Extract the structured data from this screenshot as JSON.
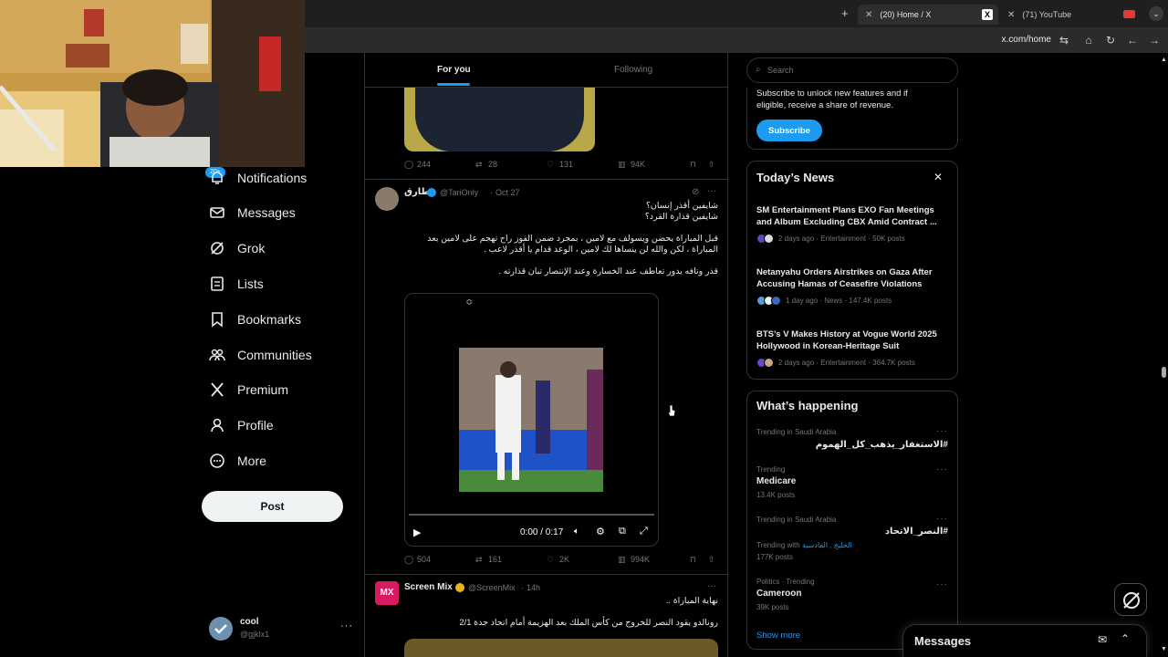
{
  "browser": {
    "tabs": [
      {
        "label": "(20) Home / X",
        "active": true
      },
      {
        "label": "(71) YouTube",
        "active": false
      }
    ],
    "address": "x.com/home"
  },
  "nav": {
    "notifications_badge": "20+",
    "items": [
      {
        "label": "Notifications",
        "icon": "bell-icon"
      },
      {
        "label": "Messages",
        "icon": "envelope-icon"
      },
      {
        "label": "Grok",
        "icon": "grok-icon"
      },
      {
        "label": "Lists",
        "icon": "list-icon"
      },
      {
        "label": "Bookmarks",
        "icon": "bookmark-icon"
      },
      {
        "label": "Communities",
        "icon": "communities-icon"
      },
      {
        "label": "Premium",
        "icon": "x-logo-icon"
      },
      {
        "label": "Profile",
        "icon": "person-icon"
      },
      {
        "label": "More",
        "icon": "more-circle-icon"
      }
    ],
    "post_label": "Post",
    "account": {
      "name": "cool",
      "handle": "@gjklx1"
    }
  },
  "feed": {
    "tabs": [
      "For you",
      "Following"
    ],
    "prev_actions": {
      "replies": "244",
      "reposts": "28",
      "likes": "131",
      "views": "94K"
    },
    "tweet1": {
      "name": "طارق",
      "handle": "@TariOnly",
      "time": "Oct 27",
      "lines": [
        "شايفين أقذر إنسان؟",
        "شايفين قذارة القرد؟",
        "قبل المباراة يحضن ويسولف مع لامين ، بمجرد ضمن الفوز راح تهجم على لامين بعد",
        "المباراة ، لكن والله لن ينساها لك لامين ، الوعد قدام يا أقذر لاعب .",
        "قذر وتافه يدور تعاطف عند الخسارة وعند الإنتصار تبان قذارته ."
      ],
      "video_time": "0:00 / 0:17",
      "actions": {
        "replies": "504",
        "reposts": "161",
        "likes": "2K",
        "views": "994K"
      }
    },
    "tweet2": {
      "name": "Screen Mix",
      "handle": "@ScreenMix",
      "time": "14h",
      "avatar_text": "MX",
      "lines": [
        "نهاية المباراة ..",
        "رونالدو يقود النصر للخروج من كأس الملك بعد الهزيمة أمام اتحاد جدة 2/1"
      ]
    }
  },
  "sidebar": {
    "search_placeholder": "Search",
    "premium": {
      "text": "Subscribe to unlock new features and if eligible, receive a share of revenue.",
      "button": "Subscribe"
    },
    "news": {
      "title": "Today’s News",
      "items": [
        {
          "title": "SM Entertainment Plans EXO Fan Meetings and Album Excluding CBX Amid Contract ...",
          "meta": "2 days ago · Entertainment · 50K posts"
        },
        {
          "title": "Netanyahu Orders Airstrikes on Gaza After Accusing Hamas of Ceasefire Violations",
          "meta": "1 day ago · News · 147.4K posts"
        },
        {
          "title": "BTS’s V Makes History at Vogue World 2025 Hollywood in Korean-Heritage Suit",
          "meta": "2 days ago · Entertainment · 364.7K posts"
        }
      ]
    },
    "happening": {
      "title": "What’s happening",
      "items": [
        {
          "context": "Trending in Saudi Arabia",
          "name": "#الاستغفار_يذهب_كل_الهموم",
          "posts": "",
          "with": ""
        },
        {
          "context": "Trending",
          "name": "Medicare",
          "posts": "13.4K posts",
          "with": ""
        },
        {
          "context": "Trending in Saudi Arabia",
          "name": "#النصر_الاتحاد",
          "posts": "177K posts",
          "with_label": "Trending with",
          "with": "الخليج , القادسية"
        },
        {
          "context": "Politics · Trending",
          "name": "Cameroon",
          "posts": "39K posts",
          "with": ""
        }
      ],
      "show_more": "Show more"
    }
  },
  "messages_drawer": {
    "label": "Messages"
  },
  "colors": {
    "accent": "#1d9bf0",
    "bg": "#000000",
    "border": "#2f3336",
    "muted": "#71767b"
  }
}
